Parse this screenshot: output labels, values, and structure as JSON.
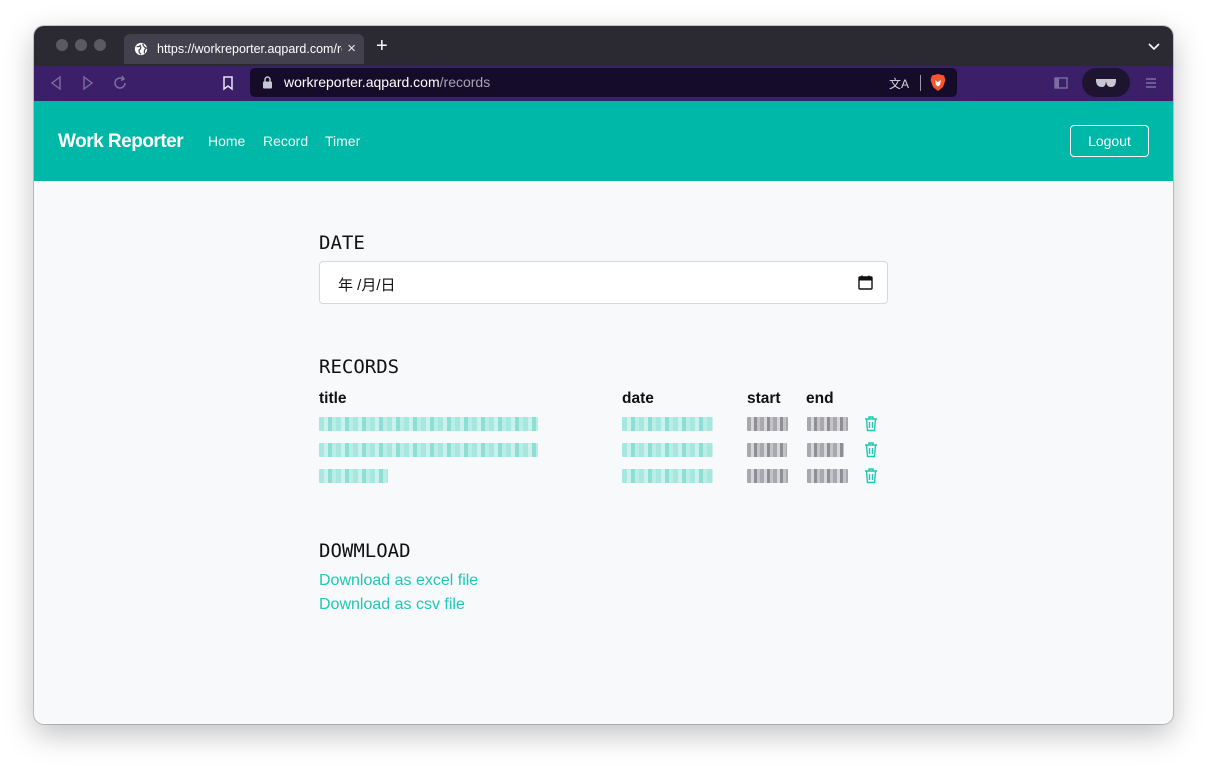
{
  "browser": {
    "tab_title": "https://workreporter.aqpard.com/records",
    "tab_close": "×",
    "new_tab": "+",
    "url_host": "workreporter.aqpard.com",
    "url_path": "/records",
    "translate_glyph": "文A"
  },
  "navbar": {
    "brand": "Work Reporter",
    "links": [
      "Home",
      "Record",
      "Timer"
    ],
    "logout_label": "Logout",
    "color": "#00b8a8"
  },
  "date_section": {
    "heading": "DATE",
    "input_value": "年 /月/日"
  },
  "records_section": {
    "heading": "RECORDS",
    "columns": [
      "title",
      "date",
      "start",
      "end"
    ],
    "rows": [
      {
        "title": "",
        "date": "",
        "start": "",
        "end": ""
      },
      {
        "title": "",
        "date": "",
        "start": "",
        "end": ""
      },
      {
        "title": "",
        "date": "",
        "start": "",
        "end": ""
      }
    ],
    "row_action_icon": "trash-icon"
  },
  "download_section": {
    "heading": "DOWMLOAD",
    "excel_link": "Download as excel file",
    "csv_link": "Download as csv file",
    "link_color": "#1fc7b4"
  }
}
